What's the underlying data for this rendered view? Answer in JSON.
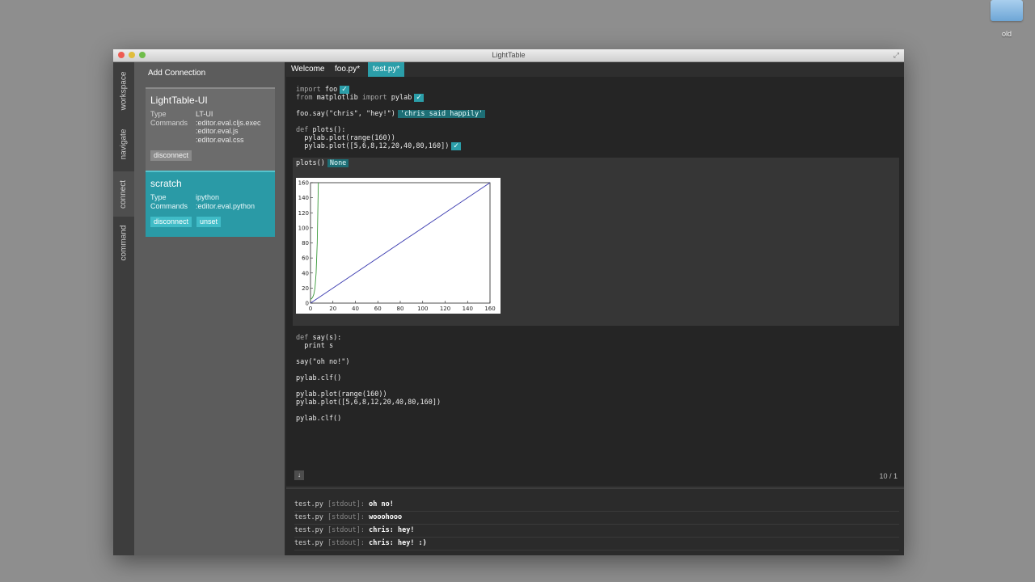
{
  "desktop": {
    "folder_label": "old"
  },
  "window": {
    "title": "LightTable",
    "fullscreen_icon": "fullscreen-icon"
  },
  "vtabs": [
    "workspace",
    "navigate",
    "connect",
    "command"
  ],
  "connections": {
    "add_label": "Add Connection",
    "items": [
      {
        "name": "LightTable-UI",
        "type_key": "Type",
        "type": "LT-UI",
        "commands_key": "Commands",
        "commands": [
          ":editor.eval.cljs.exec",
          ":editor.eval.js",
          ":editor.eval.css"
        ],
        "buttons": [
          "disconnect"
        ]
      },
      {
        "name": "scratch",
        "type_key": "Type",
        "type": "ipython",
        "commands_key": "Commands",
        "commands": [
          ":editor.eval.python"
        ],
        "buttons": [
          "disconnect",
          "unset"
        ]
      }
    ]
  },
  "tabs": [
    "Welcome",
    "foo.py*",
    "test.py*"
  ],
  "code": {
    "l1_kw": "import",
    "l1_rest": " foo",
    "l2_kw1": "from",
    "l2_mod": " matplotlib ",
    "l2_kw2": "import",
    "l2_rest": " pylab",
    "l3": "foo.say(\"chris\", \"hey!\")",
    "l3_result": "'chris said happily'",
    "l4_kw": "def",
    "l4_rest": " plots():",
    "l5": "  pylab.plot(range(160))",
    "l6": "  pylab.plot([5,6,8,12,20,40,80,160])",
    "l7": "plots()",
    "l7_result": "None",
    "l8_kw": "def",
    "l8_rest": " say(s):",
    "l9": "  print s",
    "l10": "say(\"oh no!\")",
    "l11": "pylab.clf()",
    "l12": "pylab.plot(range(160))",
    "l13": "pylab.plot([5,6,8,12,20,40,80,160])",
    "l14": "pylab.clf()",
    "check": "✓"
  },
  "chart_data": {
    "type": "line",
    "title": "",
    "xlabel": "",
    "ylabel": "",
    "xlim": [
      0,
      160
    ],
    "ylim": [
      0,
      160
    ],
    "xticks": [
      0,
      20,
      40,
      60,
      80,
      100,
      120,
      140,
      160
    ],
    "yticks": [
      0,
      20,
      40,
      60,
      80,
      100,
      120,
      140,
      160
    ],
    "series": [
      {
        "color": "#3b3bb0",
        "x": [
          0,
          160
        ],
        "y": [
          0,
          160
        ]
      },
      {
        "color": "#3a9a3a",
        "x": [
          0,
          1,
          2,
          3,
          4,
          5,
          6,
          7
        ],
        "y": [
          5,
          6,
          8,
          12,
          20,
          40,
          80,
          160
        ]
      }
    ]
  },
  "editor": {
    "scroll_icon": "↓",
    "page": "10 / 1"
  },
  "console": [
    {
      "file": "test.py",
      "stream": "[stdout]:",
      "msg": "oh no!"
    },
    {
      "file": "test.py",
      "stream": "[stdout]:",
      "msg": "wooohooo"
    },
    {
      "file": "test.py",
      "stream": "[stdout]:",
      "msg": "chris: hey!"
    },
    {
      "file": "test.py",
      "stream": "[stdout]:",
      "msg": "chris: hey! :)"
    }
  ]
}
